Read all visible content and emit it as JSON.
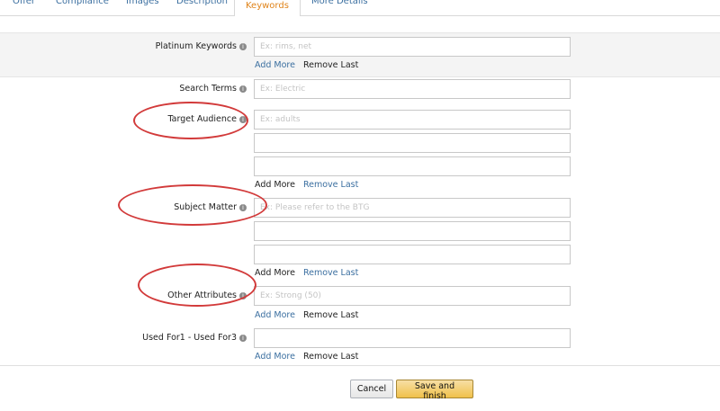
{
  "tabs": [
    {
      "label": "Offer"
    },
    {
      "label": "Compliance"
    },
    {
      "label": "Images"
    },
    {
      "label": "Description"
    },
    {
      "label": "Keywords"
    },
    {
      "label": "More Details"
    }
  ],
  "fields": {
    "platinum": {
      "label": "Platinum Keywords",
      "placeholder": "Ex: rims, net"
    },
    "search": {
      "label": "Search Terms",
      "placeholder": "Ex: Electric"
    },
    "target": {
      "label": "Target Audience",
      "placeholder": "Ex: adults"
    },
    "subject": {
      "label": "Subject Matter",
      "placeholder": "Ex: Please refer to the BTG"
    },
    "other": {
      "label": "Other Attributes",
      "placeholder": "Ex: Strong (50)"
    },
    "used": {
      "label": "Used For1 - Used For3",
      "placeholder": ""
    }
  },
  "links": {
    "add_more": "Add More",
    "remove_last": "Remove Last"
  },
  "buttons": {
    "cancel": "Cancel",
    "save": "Save and finish"
  },
  "annotation_color": "#d23a3a",
  "active_tab_color": "#e0841b"
}
